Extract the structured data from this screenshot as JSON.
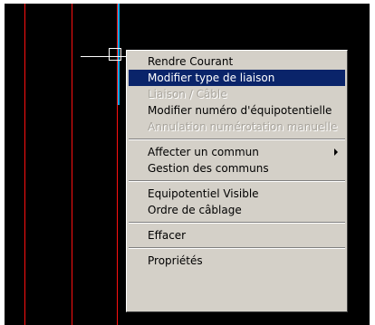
{
  "context_menu": {
    "items": [
      {
        "label": "Rendre Courant",
        "state": "normal"
      },
      {
        "label": "Modifier type de liaison",
        "state": "selected"
      },
      {
        "label": "Liaison / Câble",
        "state": "disabled"
      },
      {
        "label": "Modifier numéro d'équipotentielle",
        "state": "normal"
      },
      {
        "label": "Annulation numérotation manuelle",
        "state": "disabled"
      },
      {
        "label": "Affecter un commun",
        "state": "normal",
        "submenu": true
      },
      {
        "label": "Gestion des communs",
        "state": "normal"
      },
      {
        "label": "Equipotentiel Visible",
        "state": "normal"
      },
      {
        "label": "Ordre de câblage",
        "state": "normal"
      },
      {
        "label": "Effacer",
        "state": "normal"
      },
      {
        "label": "Propriétés",
        "state": "normal"
      }
    ]
  },
  "colors": {
    "background": "#000000",
    "wire_red": "#ff1010",
    "wire_cyan": "#0aa8e6",
    "menu_bg": "#d4d0c8",
    "selection": "#0a246a"
  }
}
